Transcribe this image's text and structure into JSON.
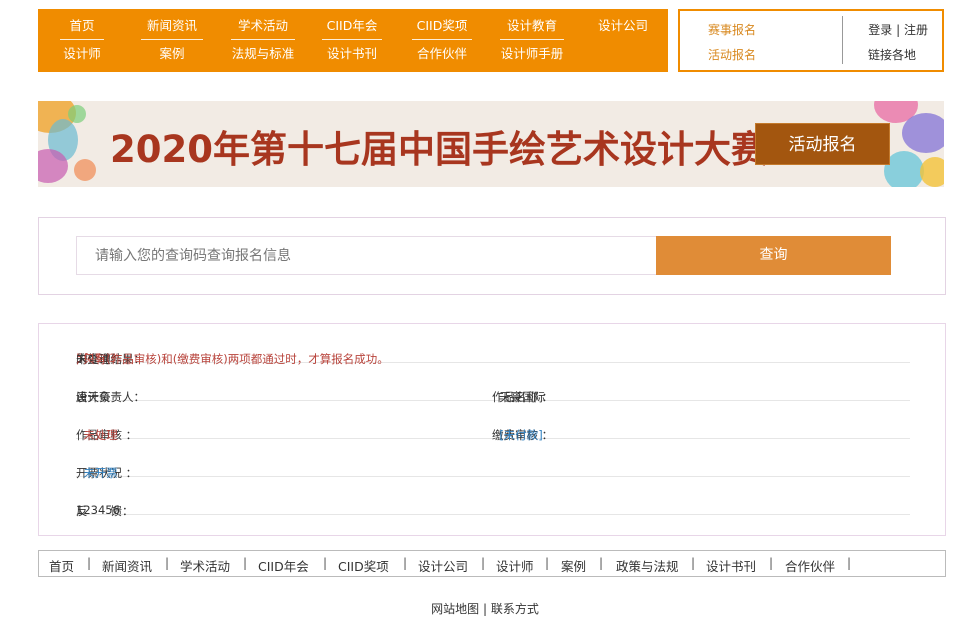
{
  "nav": {
    "columns": [
      {
        "top": "首页",
        "bottom": "设计师"
      },
      {
        "top": "新闻资讯",
        "bottom": "案例"
      },
      {
        "top": "学术活动",
        "bottom": "法规与标准"
      },
      {
        "top": "CIID年会",
        "bottom": "设计书刊"
      },
      {
        "top": "CIID奖项",
        "bottom": "合作伙伴"
      },
      {
        "top": "设计教育",
        "bottom": "设计师手册"
      },
      {
        "top": "设计公司",
        "bottom": ""
      }
    ]
  },
  "userbox": {
    "event_register": "赛事报名",
    "activity_register": "活动报名",
    "login": "登录",
    "sep": " | ",
    "register": "注册",
    "branches": "链接各地"
  },
  "banner": {
    "title": "2020年第十七届中国手绘艺术设计大赛",
    "button": "活动报名"
  },
  "search": {
    "placeholder": "请输入您的查询码查询报名信息",
    "button": "查询"
  },
  "result": {
    "code": "5fd5d3",
    "prefix": " 的查询结果：",
    "status": "未处理",
    "notice": ", 只有(作品审核)和(缴费审核)两项都通过时，才算报名成功。",
    "designer_label": "设计负责人：",
    "designer_value": "唐天豪",
    "work_label": "作品名称 ：",
    "work_value": "天豪国际",
    "review_label": "作品审核 ：",
    "review_value": "未处理",
    "payment_label": "缴费审核 ：",
    "payment_value": "[未付款]",
    "invoice_label": "开票状况 ：",
    "invoice_value": "未开票",
    "feedback_label": "反　　馈：",
    "feedback_value": "123456"
  },
  "footer": {
    "links": [
      "首页",
      "新闻资讯",
      "学术活动",
      "CIID年会",
      "CIID奖项",
      "设计公司",
      "设计师",
      "案例",
      "政策与法规",
      "设计书刊",
      "合作伙伴"
    ],
    "separator": "|",
    "sitemap": "网站地图",
    "mid": " | ",
    "contact": "联系方式"
  },
  "colors": {
    "accent": "#f08c00",
    "search_button": "#e08c37",
    "banner_title": "#a8361f",
    "status_red": "#b8433b",
    "status_blue": "#2f7fbf"
  }
}
